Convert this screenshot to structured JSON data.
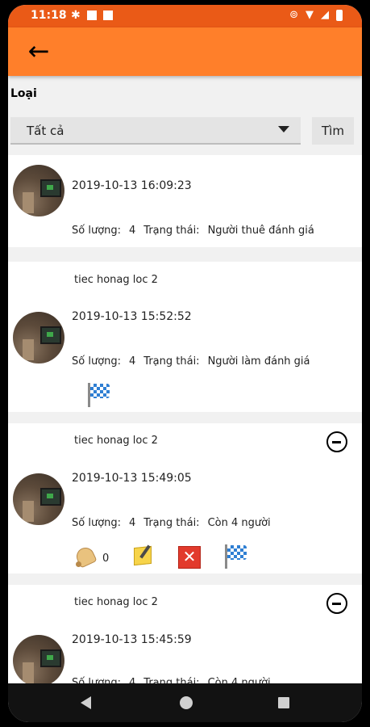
{
  "status_bar": {
    "time": "11:18",
    "left_icons": [
      "gear-icon",
      "square-notification-icon",
      "square-notification-icon"
    ],
    "right_icons": [
      "location-icon",
      "wifi-icon",
      "signal-icon",
      "battery-icon"
    ]
  },
  "app_bar": {
    "back_icon": "arrow-left-icon",
    "color": "#ff7f2a",
    "status_color": "#ea5a17"
  },
  "filter": {
    "label": "Loại",
    "selected": "Tất cả",
    "search_button": "Tìm"
  },
  "labels": {
    "quantity": "Số lượng:",
    "status": "Trạng thái:"
  },
  "orders": [
    {
      "title": "",
      "timestamp": "2019-10-13 16:09:23",
      "quantity": "4",
      "status": "Người thuê đánh giá",
      "actions": []
    },
    {
      "title": "tiec honag loc 2",
      "timestamp": "2019-10-13 15:52:52",
      "quantity": "4",
      "status": "Người làm đánh giá",
      "actions": [
        "flag-icon"
      ]
    },
    {
      "title": "tiec honag loc 2",
      "timestamp": "2019-10-13 15:49:05",
      "quantity": "4",
      "status": "Còn 4 người",
      "bell_count": "0",
      "actions": [
        "bell-icon",
        "edit-note-icon",
        "delete-icon",
        "flag-icon"
      ]
    },
    {
      "title": "tiec honag loc 2",
      "timestamp": "2019-10-13 15:45:59",
      "quantity": "4",
      "status": "Còn 4 người",
      "actions": []
    }
  ],
  "nav_bar": {
    "icons": [
      "nav-back-icon",
      "nav-home-icon",
      "nav-recents-icon"
    ]
  }
}
